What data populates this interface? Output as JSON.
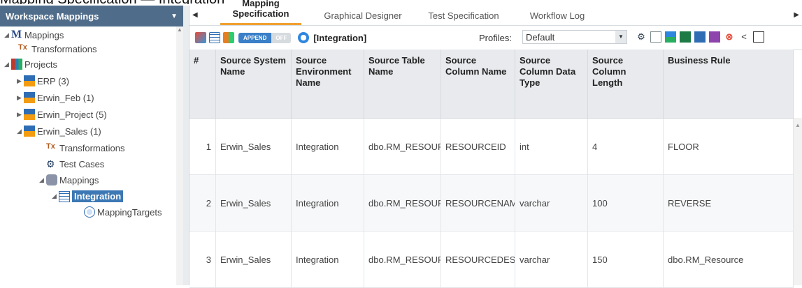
{
  "caption": "Mapping Specification — Integration",
  "left_panel": {
    "title": "Workspace Mappings",
    "tree": [
      {
        "label": "Mappings"
      },
      {
        "label": "Transformations"
      },
      {
        "label": "Projects"
      },
      {
        "label": "ERP (3)"
      },
      {
        "label": "Erwin_Feb (1)"
      },
      {
        "label": "Erwin_Project (5)"
      },
      {
        "label": "Erwin_Sales (1)"
      },
      {
        "label": "Transformations"
      },
      {
        "label": "Test Cases"
      },
      {
        "label": "Mappings"
      },
      {
        "label": "Integration"
      },
      {
        "label": "MappingTargets"
      }
    ]
  },
  "tabs": [
    {
      "label": "Mapping Specification",
      "active": true
    },
    {
      "label": "Graphical Designer"
    },
    {
      "label": "Test Specification"
    },
    {
      "label": "Workflow Log"
    }
  ],
  "toolbar": {
    "toggle_on": "APPEND",
    "toggle_off": "OFF",
    "context": "[Integration]",
    "profiles_label": "Profiles:",
    "profiles_value": "Default"
  },
  "table": {
    "headers": [
      "#",
      "Source System Name",
      "Source Environment Name",
      "Source Table Name",
      "Source Column Name",
      "Source Column Data Type",
      "Source Column Length",
      "Business Rule"
    ],
    "rows": [
      [
        "1",
        "Erwin_Sales",
        "Integration",
        "dbo.RM_RESOURCE",
        "RESOURCEID",
        "int",
        "4",
        "FLOOR"
      ],
      [
        "2",
        "Erwin_Sales",
        "Integration",
        "dbo.RM_RESOURCE",
        "RESOURCENAME",
        "varchar",
        "100",
        "REVERSE"
      ],
      [
        "3",
        "Erwin_Sales",
        "Integration",
        "dbo.RM_RESOURCE",
        "RESOURCEDESC",
        "varchar",
        "150",
        "dbo.RM_Resource"
      ]
    ]
  },
  "colors": {
    "header_bg": "#4f6c8a",
    "tab_accent": "#f0a030",
    "selected_bg": "#3c78b4",
    "toggle_on": "#3a7fc8"
  }
}
